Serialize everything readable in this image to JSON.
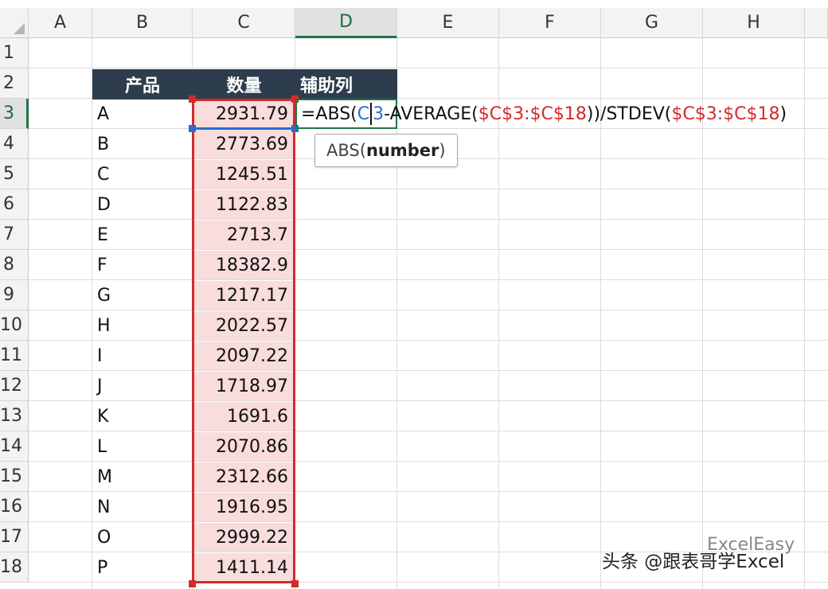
{
  "columns": [
    "A",
    "B",
    "C",
    "D",
    "E",
    "F",
    "G",
    "H"
  ],
  "active_column": "D",
  "rows": [
    "1",
    "2",
    "3",
    "4",
    "5",
    "6",
    "7",
    "8",
    "9",
    "10",
    "11",
    "12",
    "13",
    "14",
    "15",
    "16",
    "17",
    "18"
  ],
  "active_row": "3",
  "table_headers": {
    "product": "产品",
    "quantity": "数量",
    "helper": "辅助列"
  },
  "data_rows": [
    {
      "product": "A",
      "quantity": "2931.79"
    },
    {
      "product": "B",
      "quantity": "2773.69"
    },
    {
      "product": "C",
      "quantity": "1245.51"
    },
    {
      "product": "D",
      "quantity": "1122.83"
    },
    {
      "product": "E",
      "quantity": "2713.7"
    },
    {
      "product": "F",
      "quantity": "18382.9"
    },
    {
      "product": "G",
      "quantity": "1217.17"
    },
    {
      "product": "H",
      "quantity": "2022.57"
    },
    {
      "product": "I",
      "quantity": "2097.22"
    },
    {
      "product": "J",
      "quantity": "1718.97"
    },
    {
      "product": "K",
      "quantity": "1691.6"
    },
    {
      "product": "L",
      "quantity": "2070.86"
    },
    {
      "product": "M",
      "quantity": "2312.66"
    },
    {
      "product": "N",
      "quantity": "1916.95"
    },
    {
      "product": "O",
      "quantity": "2999.22"
    },
    {
      "product": "P",
      "quantity": "1411.14"
    }
  ],
  "formula": {
    "part1": "=ABS(",
    "ref_c3_a": "C",
    "ref_c3_b": "3",
    "part2": "-AVERAGE(",
    "range1": "$C$3:$C$18",
    "part3": "))/STDEV(",
    "range2": "$C$3:$C$18",
    "part4": ")"
  },
  "tooltip": {
    "fn": "ABS(",
    "arg": "number",
    "close": ")"
  },
  "watermark": {
    "text": "头条 @跟表哥学Excel",
    "faint": "ExcelEasy"
  },
  "colors": {
    "header_bg": "#2e3d4e",
    "range_border": "#d42a2a",
    "ref_blue": "#2b6cd4",
    "excel_green": "#217346",
    "range_fill": "#f9dcdc"
  }
}
